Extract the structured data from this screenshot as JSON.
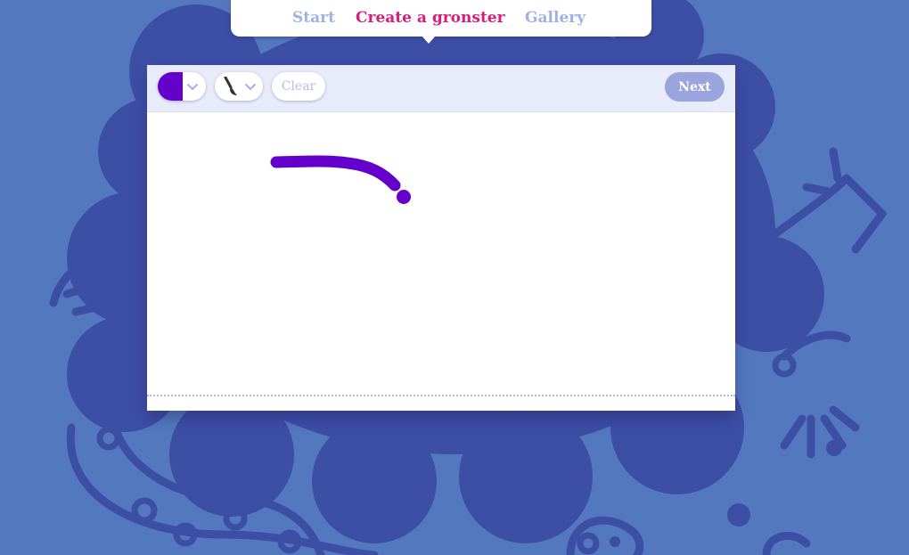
{
  "nav": {
    "items": [
      {
        "label": "Start",
        "active": false
      },
      {
        "label": "Create a gronster",
        "active": true
      },
      {
        "label": "Gallery",
        "active": false
      }
    ]
  },
  "toolbar": {
    "color_picker": {
      "selected_color": "#6500cc",
      "icon": "chevron-down-icon"
    },
    "brush_picker": {
      "icon": "brush-icon"
    },
    "clear_label": "Clear",
    "next_label": "Next"
  },
  "colors": {
    "background": "#5478c0",
    "blob": "#3d4ea5",
    "accent": "#dc1c7a",
    "stroke": "#6500cc",
    "nav_inactive": "#9fb2e3"
  }
}
